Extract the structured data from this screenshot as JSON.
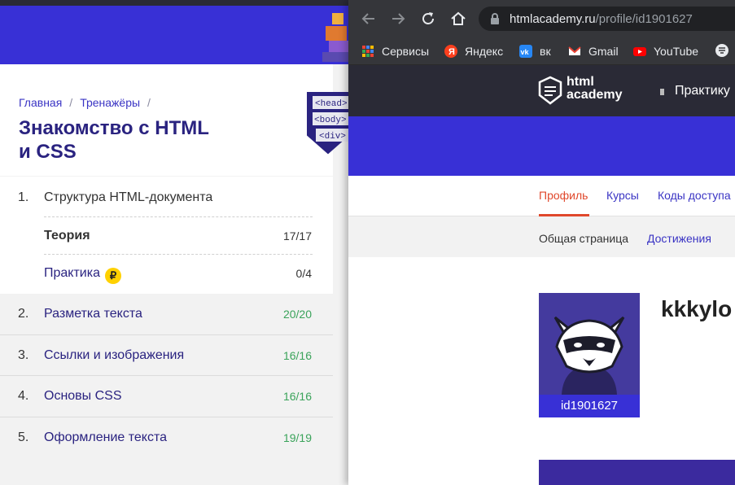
{
  "left": {
    "breadcrumb": [
      "Главная",
      "Тренажёры"
    ],
    "breadcrumb_sep": "/",
    "title_line1": "Знакомство с HTML",
    "title_line2": "и CSS",
    "badge_tags": [
      "<head>",
      "<body>",
      "<div>"
    ],
    "chapters": [
      {
        "num": "1.",
        "label": "Структура HTML-документа"
      },
      {
        "num": "2.",
        "label": "Разметка текста",
        "count": "20/20"
      },
      {
        "num": "3.",
        "label": "Ссылки и изображения",
        "count": "16/16"
      },
      {
        "num": "4.",
        "label": "Основы CSS",
        "count": "16/16"
      },
      {
        "num": "5.",
        "label": "Оформление текста",
        "count": "19/19"
      }
    ],
    "subitems": [
      {
        "label": "Теория",
        "count": "17/17"
      },
      {
        "label": "Практика",
        "count": "0/4",
        "badge": "₽"
      }
    ]
  },
  "browser": {
    "url_host": "htmlacademy.ru",
    "url_path": "/profile/id1901627",
    "bookmarks": [
      "Сервисы",
      "Яндекс",
      "вк",
      "Gmail",
      "YouTube"
    ],
    "logo_line1": "html",
    "logo_line2": "academy",
    "nav_item": "Практику",
    "tabs": [
      "Профиль",
      "Курсы",
      "Коды доступа"
    ],
    "subtabs": [
      "Общая страница",
      "Достижения"
    ],
    "user_id": "id1901627",
    "username": "kkkylo",
    "colors": {
      "brand_blue": "#3830d6",
      "active_tab": "#e0482c",
      "done_green": "#3aa35a"
    }
  }
}
